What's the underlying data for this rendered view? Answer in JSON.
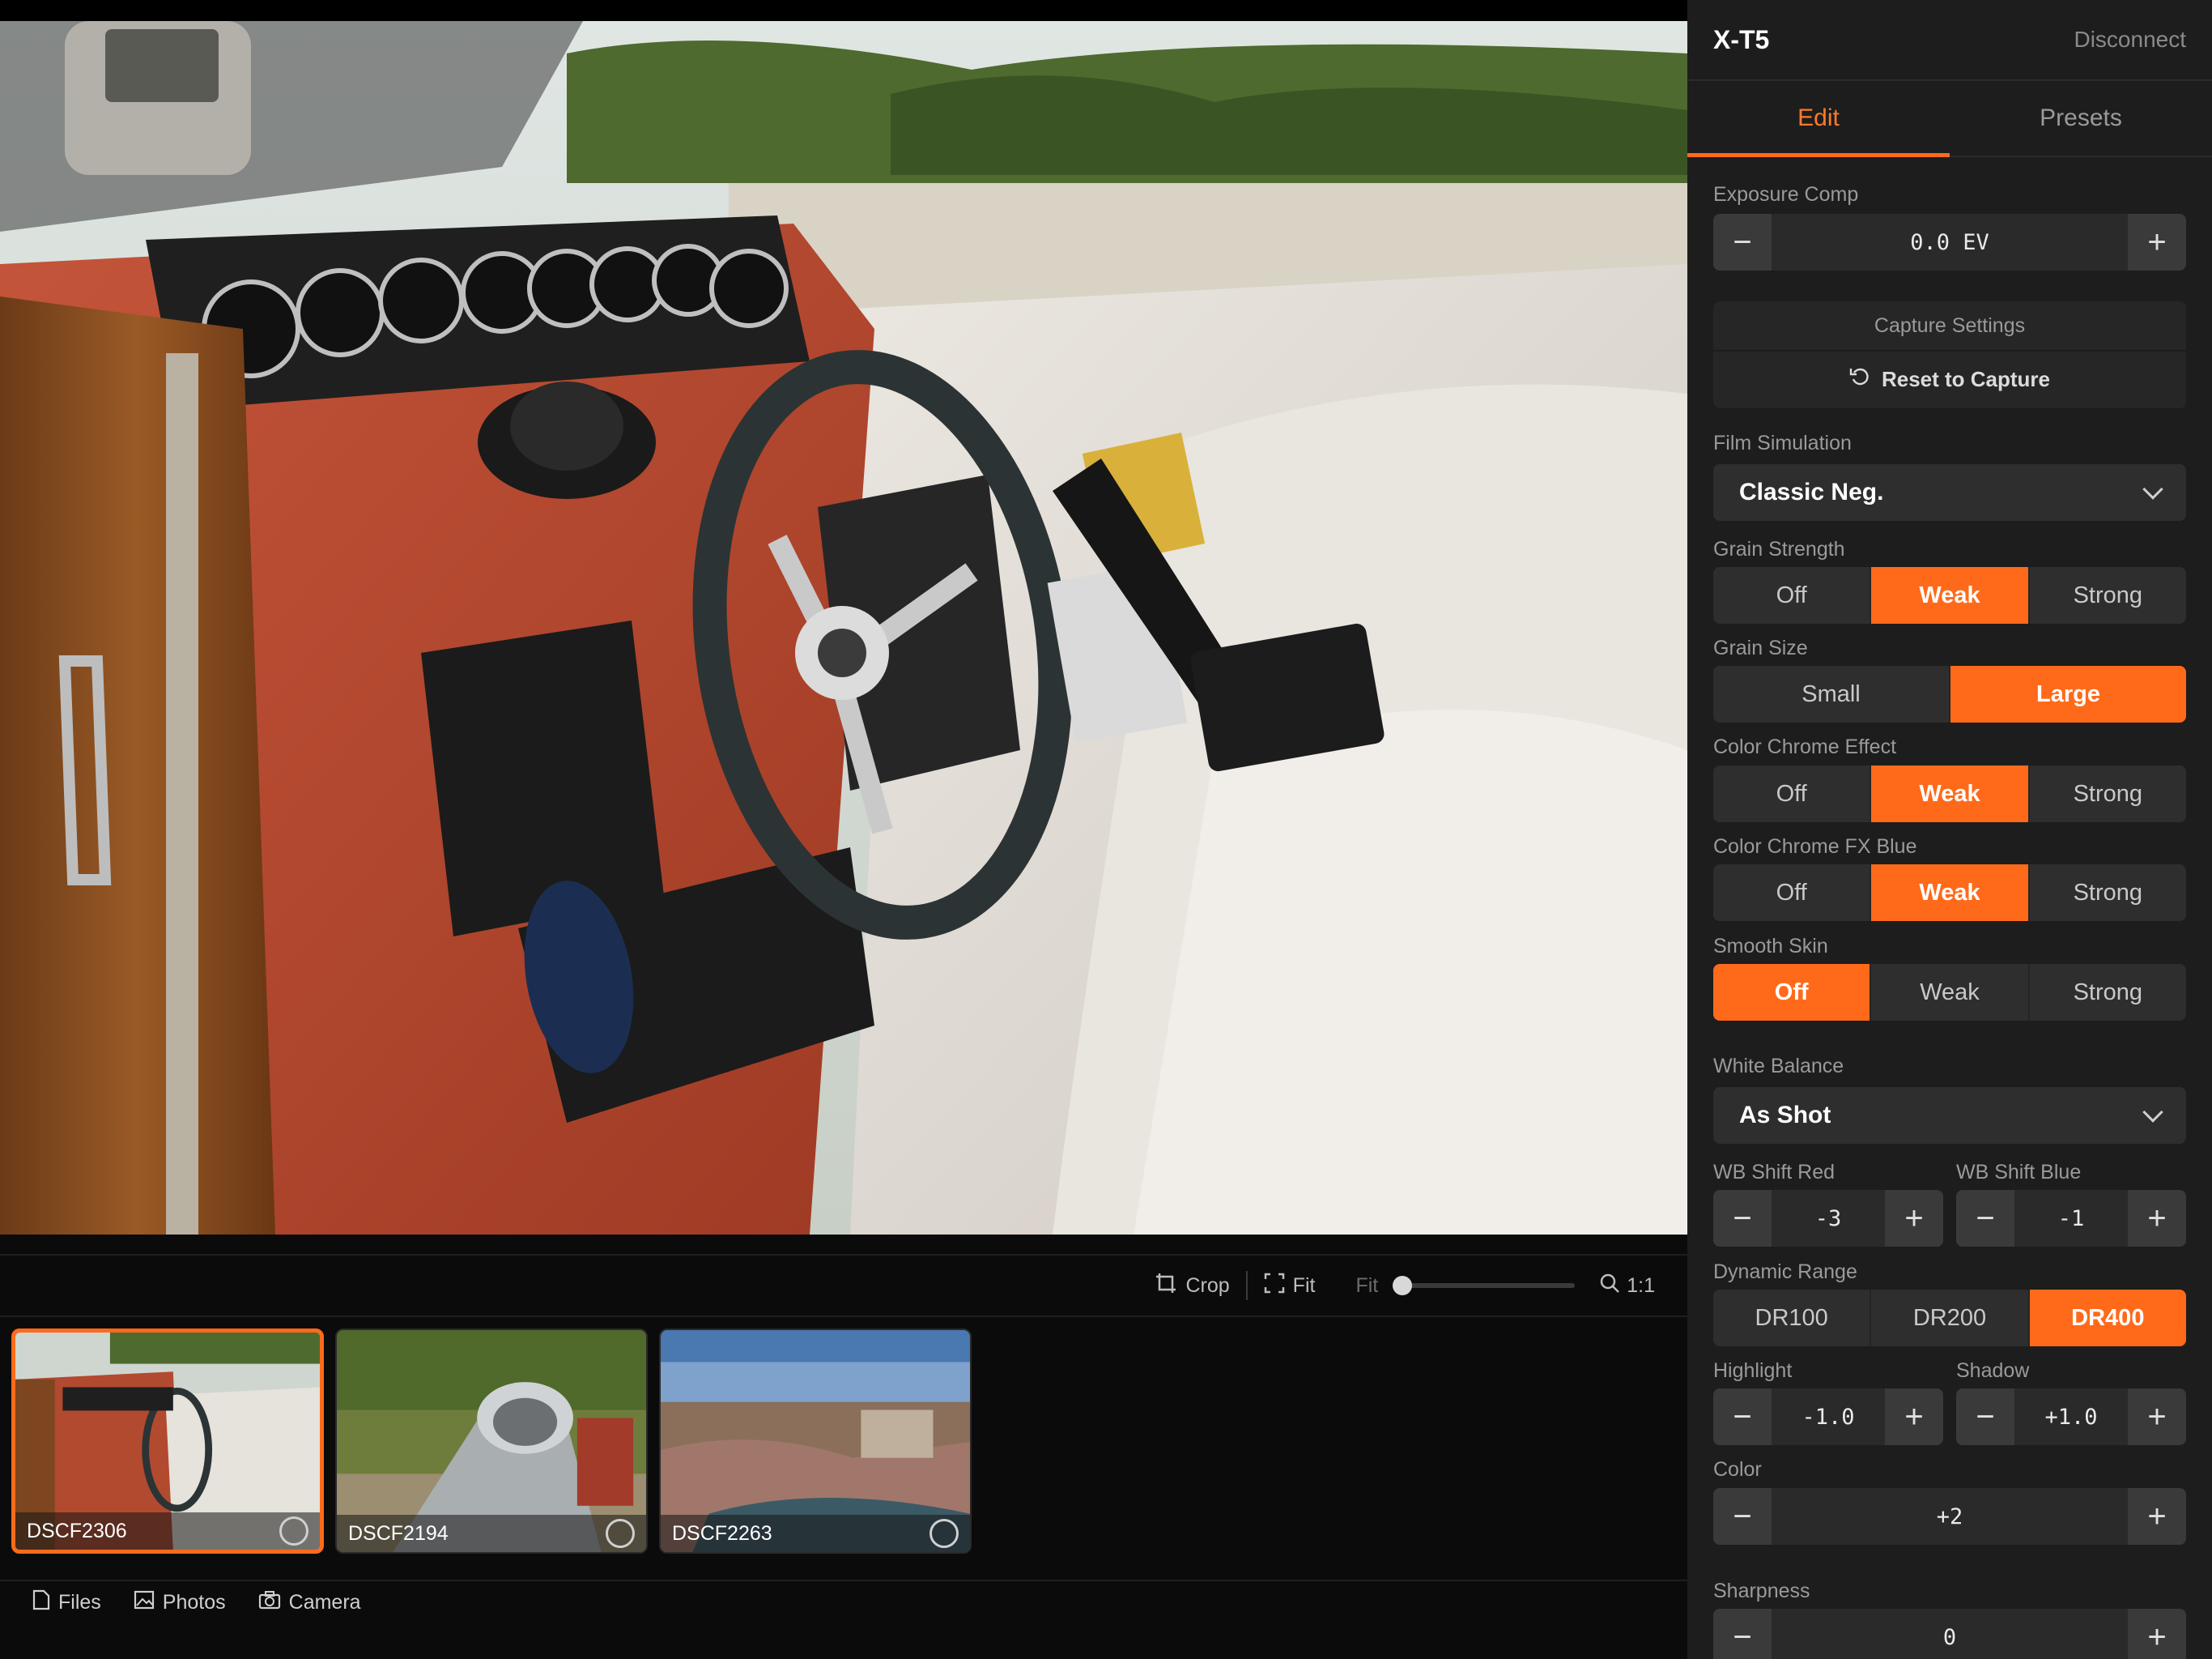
{
  "panel": {
    "camera_name": "X-T5",
    "disconnect_label": "Disconnect",
    "tabs": [
      {
        "label": "Edit",
        "active": true
      },
      {
        "label": "Presets",
        "active": false
      }
    ],
    "exposure": {
      "label": "Exposure Comp",
      "value": "0.0 EV"
    },
    "capture": {
      "title": "Capture Settings",
      "reset_label": "Reset to Capture"
    },
    "film_simulation": {
      "label": "Film Simulation",
      "value": "Classic Neg."
    },
    "grain_strength": {
      "label": "Grain Strength",
      "options": [
        "Off",
        "Weak",
        "Strong"
      ],
      "selected": "Weak"
    },
    "grain_size": {
      "label": "Grain Size",
      "options": [
        "Small",
        "Large"
      ],
      "selected": "Large"
    },
    "color_chrome": {
      "label": "Color Chrome Effect",
      "options": [
        "Off",
        "Weak",
        "Strong"
      ],
      "selected": "Weak"
    },
    "color_chrome_blue": {
      "label": "Color Chrome FX Blue",
      "options": [
        "Off",
        "Weak",
        "Strong"
      ],
      "selected": "Weak"
    },
    "smooth_skin": {
      "label": "Smooth Skin",
      "options": [
        "Off",
        "Weak",
        "Strong"
      ],
      "selected": "Off"
    },
    "white_balance": {
      "label": "White Balance",
      "value": "As Shot"
    },
    "wb_shift_red": {
      "label": "WB Shift Red",
      "value": "-3"
    },
    "wb_shift_blue": {
      "label": "WB Shift Blue",
      "value": "-1"
    },
    "dynamic_range": {
      "label": "Dynamic Range",
      "options": [
        "DR100",
        "DR200",
        "DR400"
      ],
      "selected": "DR400"
    },
    "highlight": {
      "label": "Highlight",
      "value": "-1.0"
    },
    "shadow": {
      "label": "Shadow",
      "value": "+1.0"
    },
    "color": {
      "label": "Color",
      "value": "+2"
    },
    "sharpness": {
      "label": "Sharpness",
      "value": "0"
    },
    "minus": "−",
    "plus": "+"
  },
  "toolbar": {
    "crop_label": "Crop",
    "fit_label": "Fit",
    "zoom_min_label": "Fit",
    "zoom_max_label": "1:1",
    "zoom_level": 0.0
  },
  "filmstrip": [
    {
      "name": "DSCF2306",
      "selected": true
    },
    {
      "name": "DSCF2194",
      "selected": false
    },
    {
      "name": "DSCF2263",
      "selected": false
    }
  ],
  "bottom_nav": {
    "files": "Files",
    "photos": "Photos",
    "camera": "Camera"
  },
  "colors": {
    "accent": "#ff6a1a",
    "panel_bg": "#1d1d1d"
  }
}
